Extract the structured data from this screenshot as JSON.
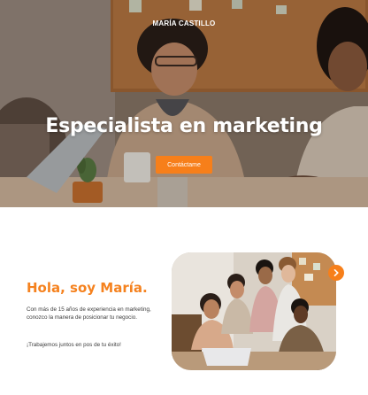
{
  "brand": {
    "name": "MARÍA CASTILLO"
  },
  "hero": {
    "title": "Especialista en marketing",
    "cta_label": "Contáctame"
  },
  "about": {
    "title": "Hola, soy María.",
    "description": "Con más de 15 años de experiencia en marketing, conozco la manera de posicionar tu negocio.",
    "closing": "¡Trabajemos juntos en pos de tu éxito!"
  },
  "icons": {
    "next": "chevron-right-icon"
  },
  "colors": {
    "accent": "#f77f1a",
    "heading_accent": "#f5821f",
    "text": "#3b3b3b"
  }
}
